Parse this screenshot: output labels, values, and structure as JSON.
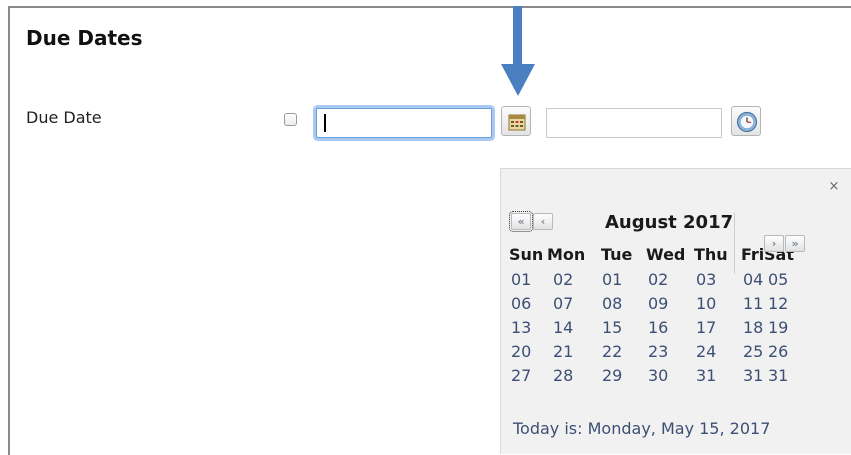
{
  "form": {
    "section_title": "Due Dates",
    "due_date_label": "Due Date",
    "due_date_enabled": false,
    "date_value": "",
    "time_value": ""
  },
  "calendar": {
    "month_title": "August 2017",
    "weekdays": [
      "Sun",
      "Mon",
      "Tue",
      "Wed",
      "Thu",
      "Fri",
      "Sat"
    ],
    "weeks": [
      [
        "01",
        "02",
        "01",
        "02",
        "03",
        "04",
        "05"
      ],
      [
        "06",
        "07",
        "08",
        "09",
        "10",
        "11",
        "12"
      ],
      [
        "13",
        "14",
        "15",
        "16",
        "17",
        "18",
        "19"
      ],
      [
        "20",
        "21",
        "22",
        "23",
        "24",
        "25",
        "26"
      ],
      [
        "27",
        "28",
        "29",
        "30",
        "31",
        "31",
        "31"
      ]
    ],
    "today_text": "Today is: Monday, May 15, 2017",
    "nav": {
      "prev_year": "«",
      "prev_month": "‹",
      "next_month": "›",
      "next_year": "»",
      "close": "×"
    }
  },
  "icons": {
    "calendar": "calendar-icon",
    "clock": "clock-icon",
    "annotation_arrow": "arrow-down-icon"
  },
  "colors": {
    "accent_arrow": "#4a7fc1",
    "focus_ring": "#a9c9f3",
    "day_text": "#3d4f73",
    "popup_bg": "#f1f1f1"
  }
}
